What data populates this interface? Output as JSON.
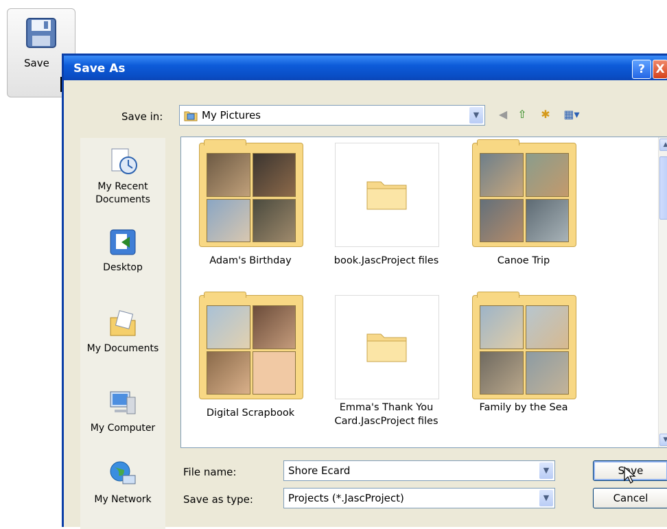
{
  "toolbar": {
    "save_label": "Save"
  },
  "dialog": {
    "title": "Save As",
    "help_glyph": "?",
    "close_glyph": "X",
    "save_in_label": "Save in:",
    "save_in_value": "My Pictures",
    "places": [
      {
        "label": "My Recent Documents",
        "icon": "recent-documents-icon"
      },
      {
        "label": "Desktop",
        "icon": "desktop-icon"
      },
      {
        "label": "My Documents",
        "icon": "my-documents-icon"
      },
      {
        "label": "My Computer",
        "icon": "my-computer-icon"
      },
      {
        "label": "My Network",
        "icon": "my-network-icon"
      }
    ],
    "files": [
      {
        "name": "Adam's Birthday"
      },
      {
        "name": "book.JascProject files"
      },
      {
        "name": "Canoe Trip"
      },
      {
        "name": "Digital Scrapbook"
      },
      {
        "name": "Emma's Thank You Card.JascProject files"
      },
      {
        "name": "Family by the Sea"
      }
    ],
    "file_name_label": "File name:",
    "file_name_value": "Shore Ecard",
    "save_type_label": "Save as type:",
    "save_type_value": "Projects (*.JascProject)",
    "save_button": "Save",
    "cancel_button": "Cancel"
  },
  "colors": {
    "titlebar": "#0b4fc7",
    "dialog_bg": "#ece9d8",
    "folder": "#f8d884"
  }
}
